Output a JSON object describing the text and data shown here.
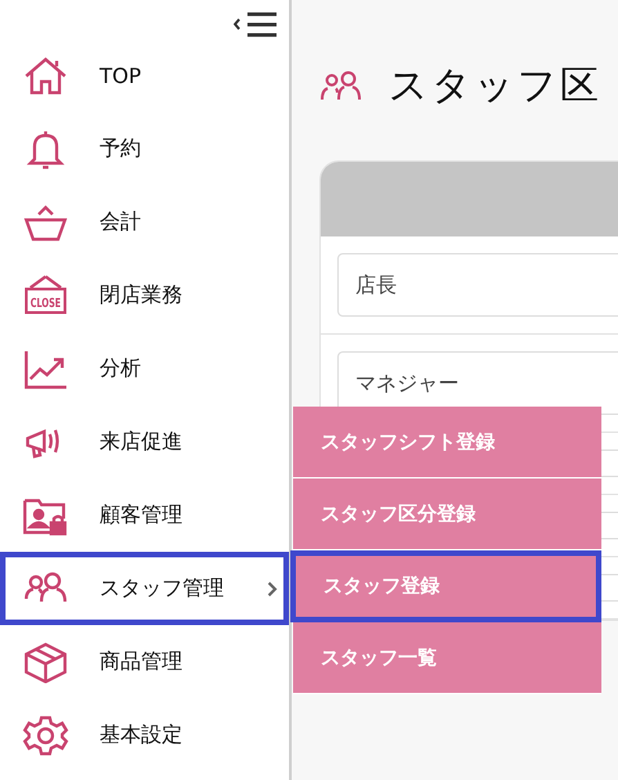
{
  "sidebar": {
    "items": [
      {
        "label": "TOP",
        "selected": false,
        "submenu": false
      },
      {
        "label": "予約",
        "selected": false,
        "submenu": false
      },
      {
        "label": "会計",
        "selected": false,
        "submenu": false
      },
      {
        "label": "閉店業務",
        "selected": false,
        "submenu": false,
        "icon_text": "CLOSE"
      },
      {
        "label": "分析",
        "selected": false,
        "submenu": false
      },
      {
        "label": "来店促進",
        "selected": false,
        "submenu": false
      },
      {
        "label": "顧客管理",
        "selected": false,
        "submenu": false
      },
      {
        "label": "スタッフ管理",
        "selected": true,
        "submenu": true
      },
      {
        "label": "商品管理",
        "selected": false,
        "submenu": false
      },
      {
        "label": "基本設定",
        "selected": false,
        "submenu": false
      }
    ]
  },
  "page": {
    "title": "スタッフ区",
    "fields": [
      {
        "value": "店長"
      },
      {
        "value": "マネジャー"
      }
    ]
  },
  "submenu": {
    "items": [
      {
        "label": "スタッフシフト登録",
        "selected": false
      },
      {
        "label": "スタッフ区分登録",
        "selected": false
      },
      {
        "label": "スタッフ登録",
        "selected": true
      },
      {
        "label": "スタッフ一覧",
        "selected": false
      }
    ]
  }
}
